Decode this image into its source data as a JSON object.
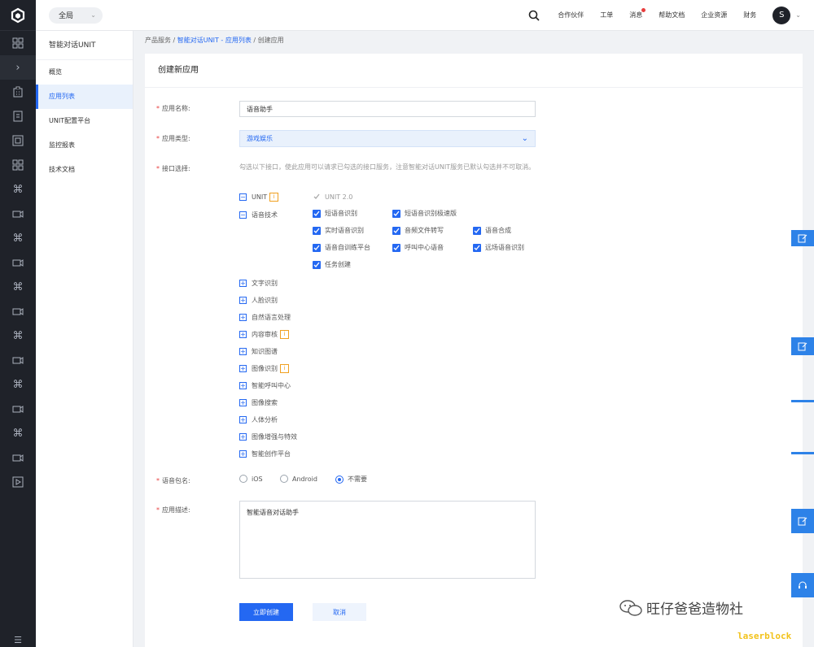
{
  "topbar": {
    "scope": "全局",
    "nav": [
      "合作伙伴",
      "工单",
      "消息",
      "帮助文档",
      "企业资源",
      "财务"
    ],
    "avatar": "S"
  },
  "sidebar": {
    "title": "智能对话UNIT",
    "items": [
      "概览",
      "应用列表",
      "UNIT配置平台",
      "监控报表",
      "技术文档"
    ],
    "active_index": 1
  },
  "breadcrumb": {
    "root": "产品服务",
    "sep": "/",
    "link": "智能对话UNIT - 应用列表",
    "current": "创建应用"
  },
  "form": {
    "header": "创建新应用",
    "app_name": {
      "label": "应用名称:",
      "value": "语音助手"
    },
    "app_type": {
      "label": "应用类型:",
      "value": "游戏娱乐"
    },
    "api": {
      "label": "接口选择:",
      "hint": "勾选以下接口，使此应用可以请求已勾选的接口服务，注意智能对话UNIT服务已默认勾选并不可取消。",
      "unit": "UNIT",
      "unit_sub": "UNIT 2.0",
      "speech": "语音技术",
      "speech_items": [
        "短语音识别",
        "短语音识别极速版",
        "实时语音识别",
        "音频文件转写",
        "语音合成",
        "语音自训练平台",
        "呼叫中心语音",
        "远场语音识别",
        "任务创建"
      ],
      "groups": [
        "文字识别",
        "人脸识别",
        "自然语言处理",
        "内容审核",
        "知识图谱",
        "图像识别",
        "智能呼叫中心",
        "图像搜索",
        "人体分析",
        "图像增强与特效",
        "智能创作平台"
      ],
      "badge": "i"
    },
    "package": {
      "label": "语音包名:",
      "options": [
        "iOS",
        "Android",
        "不需要"
      ],
      "selected": "不需要"
    },
    "desc": {
      "label": "应用描述:",
      "value": "智能语音对话助手"
    },
    "submit": "立即创建",
    "cancel": "取消"
  },
  "watermark": {
    "text": "旺仔爸爸造物社",
    "tag": "laserblock"
  },
  "colors": {
    "primary": "#2468f2",
    "rail": "#1f2229",
    "badge": "#f0a020"
  }
}
